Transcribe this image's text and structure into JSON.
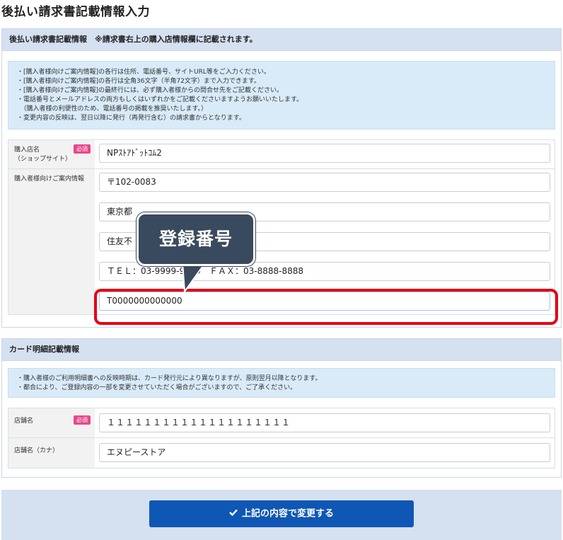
{
  "page": {
    "title": "後払い請求書記載情報入力"
  },
  "invoice_panel": {
    "heading": "後払い請求書記載情報　※請求書右上の購入店情報欄に記載されます。",
    "notes": [
      "・[購入者様向けご案内情報]の各行は住所、電話番号、サイトURL等をご入力ください。",
      "・[購入者様向けご案内情報]の各行は全角36文字（半角72文字）まで入力できます。",
      "・[購入者様向けご案内情報]の最終行には、必ず購入者様からの問合せ先をご記載ください。",
      "・電話番号とメールアドレスの両方もしくはいずれかをご記載くださいますようお願いいたします。",
      "　（購入者様の利便性のため、電話番号の掲載を推奨いたします。）",
      "・変更内容の反映は、翌日以降に発行（再発行含む）の請求書からとなります。"
    ],
    "shop_name": {
      "label_line1": "購入店名",
      "label_line2": "（ショップサイト）",
      "required_badge": "必須",
      "value": "NPｽﾄｱﾄﾞｯﾄｺﾑ2"
    },
    "buyer_info": {
      "label": "購入者様向けご案内情報",
      "lines": [
        "〒102-0083",
        "東京都",
        "住友不",
        "ＴＥＬ：03-9999-9999　ＦＡＸ：03-8888-8888",
        "T0000000000000"
      ]
    }
  },
  "callout": {
    "text": "登録番号"
  },
  "card_panel": {
    "heading": "カード明細記載情報",
    "notes": [
      "・購入者様のご利用明細書への反映時期は、カード発行元により異なりますが、原則翌月以降となります。",
      "・都合により、ご登録内容の一部を変更させていただく場合がございますので、ご了承ください。"
    ],
    "store_name": {
      "label": "店舗名",
      "required_badge": "必須",
      "value": "１１１１１１１１１１１１１１１１１１１１"
    },
    "store_name_kana": {
      "label": "店舗名（カナ）",
      "value": "エヌピーストア"
    }
  },
  "submit": {
    "label": "上記の内容で変更する",
    "icon": "check-icon"
  },
  "colors": {
    "accent": "#0f57b4",
    "highlight": "#e60012",
    "required": "#e8478a",
    "callout": "#3a4a5e"
  }
}
